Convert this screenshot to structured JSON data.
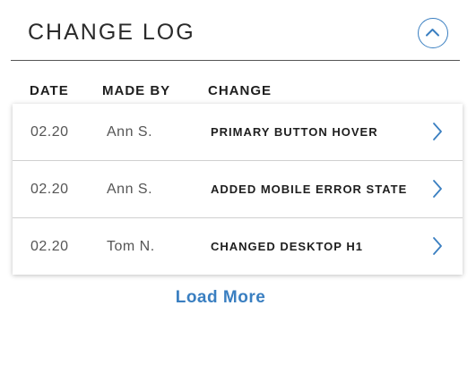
{
  "header": {
    "title": "CHANGE LOG",
    "collapse_icon": "chevron-up-icon"
  },
  "columns": {
    "date": "DATE",
    "made_by": "MADE BY",
    "change": "CHANGE"
  },
  "rows": [
    {
      "date": "02.20",
      "made_by": "Ann S.",
      "change": "PRIMARY BUTTON HOVER",
      "icon": "chevron-right-icon"
    },
    {
      "date": "02.20",
      "made_by": "Ann S.",
      "change": "ADDED MOBILE ERROR STATE",
      "icon": "chevron-right-icon"
    },
    {
      "date": "02.20",
      "made_by": "Tom N.",
      "change": "CHANGED DESKTOP H1",
      "icon": "chevron-right-icon"
    }
  ],
  "load_more": "Load More",
  "colors": {
    "accent": "#3a7fc1",
    "divider": "#555555",
    "row_border": "#cfcfcf",
    "text_dark": "#1e1e1e",
    "text_muted": "#555555"
  }
}
